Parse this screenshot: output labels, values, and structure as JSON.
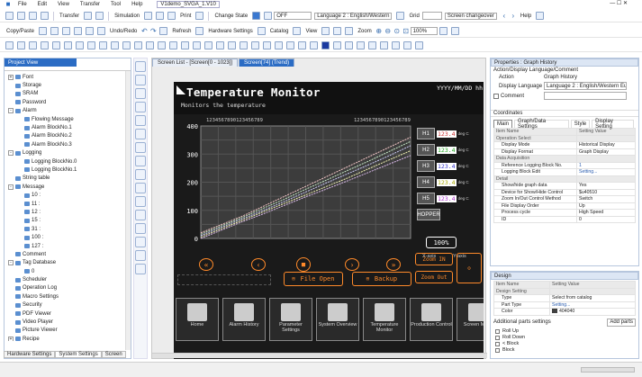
{
  "window": {
    "title": "V1demo_SVGA_1.V10"
  },
  "menu": [
    "File",
    "Edit",
    "View",
    "Transfer",
    "Tool",
    "Help"
  ],
  "toolbar1": {
    "transfer": "Transfer",
    "simulation": "Simulation",
    "print": "Print",
    "change_state": "Change State",
    "state_value": "OFF",
    "language": "Language 2 : English/Western",
    "grid": "Grid",
    "screen_changeover": "Screen changeover",
    "help": "Help"
  },
  "toolbar2": {
    "copy_paste": "Copy/Paste",
    "undo_redo": "Undo/Redo",
    "refresh": "Refresh",
    "hardware_settings": "Hardware Settings",
    "catalog": "Catalog",
    "view": "View",
    "zoom": "Zoom",
    "zoom_value": "100%"
  },
  "project_view": {
    "title": "Project View",
    "items": [
      {
        "label": "Font",
        "level": 0,
        "toggle": "+"
      },
      {
        "label": "Storage",
        "level": 0,
        "toggle": ""
      },
      {
        "label": "SRAM",
        "level": 0,
        "toggle": ""
      },
      {
        "label": "Password",
        "level": 0,
        "toggle": ""
      },
      {
        "label": "Alarm",
        "level": 0,
        "toggle": "-"
      },
      {
        "label": "Flowing Message",
        "level": 1,
        "toggle": ""
      },
      {
        "label": "Alarm BlockNo.1",
        "level": 1,
        "toggle": ""
      },
      {
        "label": "Alarm BlockNo.2",
        "level": 1,
        "toggle": ""
      },
      {
        "label": "Alarm BlockNo.3",
        "level": 1,
        "toggle": ""
      },
      {
        "label": "Logging",
        "level": 0,
        "toggle": "-"
      },
      {
        "label": "Logging BlockNo.0",
        "level": 1,
        "toggle": ""
      },
      {
        "label": "Logging BlockNo.1",
        "level": 1,
        "toggle": ""
      },
      {
        "label": "String table",
        "level": 0,
        "toggle": ""
      },
      {
        "label": "Message",
        "level": 0,
        "toggle": "-"
      },
      {
        "label": "10 :",
        "level": 1,
        "toggle": ""
      },
      {
        "label": "11 :",
        "level": 1,
        "toggle": ""
      },
      {
        "label": "12 :",
        "level": 1,
        "toggle": ""
      },
      {
        "label": "15 :",
        "level": 1,
        "toggle": ""
      },
      {
        "label": "31 :",
        "level": 1,
        "toggle": ""
      },
      {
        "label": "100 :",
        "level": 1,
        "toggle": ""
      },
      {
        "label": "127 :",
        "level": 1,
        "toggle": ""
      },
      {
        "label": "Comment",
        "level": 0,
        "toggle": ""
      },
      {
        "label": "Tag Database",
        "level": 0,
        "toggle": "-"
      },
      {
        "label": "0",
        "level": 1,
        "toggle": ""
      },
      {
        "label": "Scheduler",
        "level": 0,
        "toggle": ""
      },
      {
        "label": "Operation Log",
        "level": 0,
        "toggle": ""
      },
      {
        "label": "Macro Settings",
        "level": 0,
        "toggle": ""
      },
      {
        "label": "Security",
        "level": 0,
        "toggle": ""
      },
      {
        "label": "PDF Viewer",
        "level": 0,
        "toggle": ""
      },
      {
        "label": "Video Player",
        "level": 0,
        "toggle": ""
      },
      {
        "label": "Picture Viewer",
        "level": 0,
        "toggle": ""
      },
      {
        "label": "Recipe",
        "level": 0,
        "toggle": "+"
      }
    ],
    "bottom_tabs": [
      "Hardware Settings",
      "System Settings",
      "Screen"
    ]
  },
  "editor": {
    "tabs": [
      "Screen List - [Screen[0 - 1023]]",
      "Screen[74] (Trend)"
    ],
    "screen": {
      "title": "Temperature Monitor",
      "subtitle": "Monitors the temperature",
      "datetime": "YYYY/MM/DD hh",
      "header_digits": "1234567890123456789",
      "header_digits2": "1234567890123456789",
      "y_ticks": [
        "400",
        "300",
        "200",
        "100",
        "0"
      ],
      "series_labels": [
        "H1",
        "H2",
        "H3",
        "H4",
        "H5",
        "HOPPER"
      ],
      "value_text": "123.4",
      "unit_text": "deg C",
      "percent": "100%",
      "x_axis": "X-axis",
      "y_axis": "Y-axis",
      "file_open": "File Open",
      "backup": "Backup",
      "zoom_in": "Zoom IN",
      "zoom_out": "Zoom Out",
      "nav_buttons": [
        "Home",
        "Alarm History",
        "Parameter Settings",
        "System Overview",
        "Temperature Monitor",
        "Production Control",
        "Screen Maint"
      ]
    },
    "chart_data": {
      "type": "line",
      "ylim": [
        0,
        400
      ],
      "x": [
        0,
        1,
        2,
        3,
        4,
        5,
        6,
        7,
        8,
        9,
        10
      ],
      "series": [
        {
          "values": [
            20,
            50,
            80,
            115,
            150,
            185,
            220,
            255,
            290,
            325,
            360
          ],
          "color": "#f3c6c6"
        },
        {
          "values": [
            15,
            45,
            75,
            108,
            140,
            175,
            208,
            242,
            275,
            310,
            345
          ],
          "color": "#c6e8c6"
        },
        {
          "values": [
            10,
            40,
            70,
            100,
            132,
            165,
            198,
            230,
            262,
            295,
            330
          ],
          "color": "#c8c8f4"
        },
        {
          "values": [
            5,
            35,
            65,
            95,
            125,
            155,
            185,
            215,
            248,
            280,
            312
          ],
          "color": "#f0f0b0"
        },
        {
          "values": [
            0,
            30,
            60,
            88,
            118,
            148,
            176,
            205,
            235,
            265,
            295
          ],
          "color": "#d8b8e8"
        }
      ]
    }
  },
  "properties": {
    "title": "Properties : Graph History",
    "subtitle": "Action/Display Language/Comment",
    "action_label": "Action",
    "action_value": "Graph History",
    "display_language_label": "Display Language",
    "display_language_value": "Language 2 : English/Western Eur",
    "comment_label": "Comment",
    "coordinates_label": "Coordinates",
    "tabs": [
      "Main",
      "Graph/Data Settings",
      "Style",
      "Display Setting"
    ],
    "col_item": "Item Name",
    "col_value": "Setting Value",
    "rows": [
      {
        "type": "sec",
        "name": "Operation Select",
        "value": ""
      },
      {
        "type": "row",
        "name": "Display Mode",
        "value": "Historical Display"
      },
      {
        "type": "row",
        "name": "Display Format",
        "value": "Graph Display"
      },
      {
        "type": "sec",
        "name": "Data Acquisition",
        "value": ""
      },
      {
        "type": "row",
        "name": "Reference Logging Block No.",
        "value": "1"
      },
      {
        "type": "row",
        "name": "Logging Block Edit",
        "value": "Setting..."
      },
      {
        "type": "sec",
        "name": "Detail",
        "value": ""
      },
      {
        "type": "row",
        "name": "Show/hide graph data",
        "value": "Yes"
      },
      {
        "type": "row",
        "name": "Device for Show/Hide Control",
        "value": "$u40510"
      },
      {
        "type": "row",
        "name": "Zoom In/Out Control Method",
        "value": "Switch"
      },
      {
        "type": "row",
        "name": "File Display Order",
        "value": "Up"
      },
      {
        "type": "row",
        "name": "Process cycle",
        "value": "High Speed"
      },
      {
        "type": "row",
        "name": "ID",
        "value": "0"
      }
    ]
  },
  "design": {
    "title": "Design",
    "col_item": "Item Name",
    "col_value": "Setting Value",
    "rows": [
      {
        "type": "sec",
        "name": "Design Setting",
        "value": ""
      },
      {
        "type": "row",
        "name": "Type",
        "value": "Select from catalog"
      },
      {
        "type": "row",
        "name": "Part Type",
        "value": "Setting..."
      },
      {
        "type": "row",
        "name": "Color",
        "value": "404040"
      }
    ],
    "parts_label": "Additional parts settings",
    "add_parts": "Add parts",
    "parts": [
      "Roll Up",
      "Roll Down",
      "< Block",
      "Block"
    ]
  }
}
